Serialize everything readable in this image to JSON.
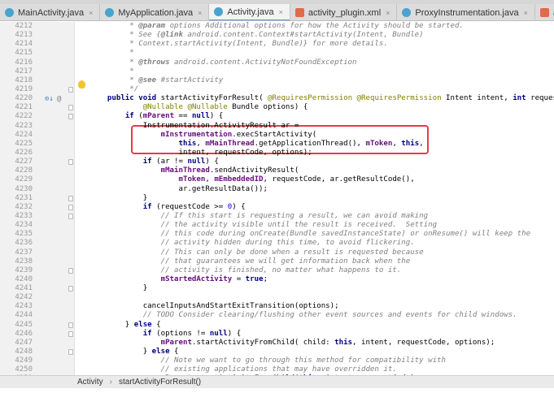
{
  "tabs": [
    {
      "label": "MainActivity.java",
      "kind": "cls",
      "active": false
    },
    {
      "label": "MyApplication.java",
      "kind": "cls",
      "active": false
    },
    {
      "label": "Activity.java",
      "kind": "cls",
      "active": true
    },
    {
      "label": "activity_plugin.xml",
      "kind": "layout",
      "active": false
    },
    {
      "label": "ProxyInstrumentation.java",
      "kind": "cls",
      "active": false
    },
    {
      "label": "activity_main.xml",
      "kind": "layout",
      "active": false
    }
  ],
  "tab_close_glyph": "×",
  "breadcrumb": {
    "class": "Activity",
    "method": "startActivityForResult()",
    "separator": "›"
  },
  "gutter_marks": {
    "override": "⊙↓",
    "at": "@"
  },
  "lines": [
    {
      "n": "4212",
      "t": "         * @param options Additional options for how the Activity should be started."
    },
    {
      "n": "4213",
      "t": "         * See {@link android.content.Context#startActivity(Intent, Bundle)"
    },
    {
      "n": "4214",
      "t": "         * Context.startActivity(Intent, Bundle)} for more details."
    },
    {
      "n": "4215",
      "t": "         *"
    },
    {
      "n": "4216",
      "t": "         * @throws android.content.ActivityNotFoundException"
    },
    {
      "n": "4217",
      "t": "         *"
    },
    {
      "n": "4218",
      "t": "         * @see #startActivity"
    },
    {
      "n": "4219",
      "t": "         */"
    },
    {
      "n": "4220",
      "t": "    public void startActivityForResult( @RequiresPermission @RequiresPermission Intent intent, int requestCode,"
    },
    {
      "n": "4221",
      "t": "            @Nullable @Nullable Bundle options) {"
    },
    {
      "n": "4222",
      "t": "        if (mParent == null) {"
    },
    {
      "n": "4223",
      "t": "            Instrumentation.ActivityResult ar ="
    },
    {
      "n": "4224",
      "t": "                mInstrumentation.execStartActivity("
    },
    {
      "n": "4225",
      "t": "                    this, mMainThread.getApplicationThread(), mToken, this,"
    },
    {
      "n": "4226",
      "t": "                    intent, requestCode, options);"
    },
    {
      "n": "4227",
      "t": "            if (ar != null) {"
    },
    {
      "n": "4228",
      "t": "                mMainThread.sendActivityResult("
    },
    {
      "n": "4229",
      "t": "                    mToken, mEmbeddedID, requestCode, ar.getResultCode(),"
    },
    {
      "n": "4230",
      "t": "                    ar.getResultData());"
    },
    {
      "n": "4231",
      "t": "            }"
    },
    {
      "n": "4232",
      "t": "            if (requestCode >= 0) {"
    },
    {
      "n": "4233",
      "t": "                // If this start is requesting a result, we can avoid making"
    },
    {
      "n": "4234",
      "t": "                // the activity visible until the result is received.  Setting"
    },
    {
      "n": "4235",
      "t": "                // this code during onCreate(Bundle savedInstanceState) or onResume() will keep the"
    },
    {
      "n": "4236",
      "t": "                // activity hidden during this time, to avoid flickering."
    },
    {
      "n": "4237",
      "t": "                // This can only be done when a result is requested because"
    },
    {
      "n": "4238",
      "t": "                // that guarantees we will get information back when the"
    },
    {
      "n": "4239",
      "t": "                // activity is finished, no matter what happens to it."
    },
    {
      "n": "4240",
      "t": "                mStartedActivity = true;"
    },
    {
      "n": "4241",
      "t": "            }"
    },
    {
      "n": "4242",
      "t": ""
    },
    {
      "n": "4243",
      "t": "            cancelInputsAndStartExitTransition(options);"
    },
    {
      "n": "4244",
      "t": "            // TODO Consider clearing/flushing other event sources and events for child windows."
    },
    {
      "n": "4245",
      "t": "        } else {"
    },
    {
      "n": "4246",
      "t": "            if (options != null) {"
    },
    {
      "n": "4247",
      "t": "                mParent.startActivityFromChild( child: this, intent, requestCode, options);"
    },
    {
      "n": "4248",
      "t": "            } else {"
    },
    {
      "n": "4249",
      "t": "                // Note we want to go through this method for compatibility with"
    },
    {
      "n": "4250",
      "t": "                // existing applications that may have overridden it."
    },
    {
      "n": "4251",
      "t": "                mParent.startActivityFromChild(this, intent, requestCode);"
    }
  ]
}
